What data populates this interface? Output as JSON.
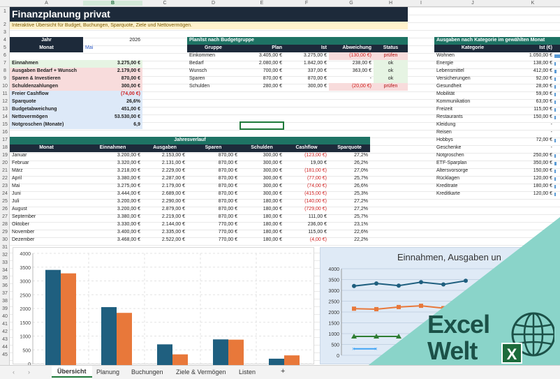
{
  "columns": [
    "A",
    "B",
    "C",
    "D",
    "E",
    "F",
    "G",
    "H",
    "I",
    "J",
    "K"
  ],
  "rows": [
    "1",
    "2",
    "3",
    "4",
    "5",
    "6",
    "7",
    "8",
    "9",
    "10",
    "11",
    "12",
    "13",
    "14",
    "15",
    "16",
    "17",
    "18",
    "19",
    "20",
    "21",
    "22",
    "23",
    "24",
    "25",
    "26",
    "27",
    "28",
    "29",
    "30",
    "31",
    "32",
    "33",
    "34",
    "35",
    "36",
    "37",
    "38",
    "39",
    "40",
    "41",
    "42",
    "43",
    "44",
    "45"
  ],
  "title": "Finanzplanung privat",
  "subtitle": "Interaktive Übersicht für Budget, Buchungen, Sparquote, Ziele und Nettovermögen.",
  "summary": {
    "jahr_label": "Jahr",
    "jahr_value": "2026",
    "monat_label": "Monat",
    "monat_value": "Mai",
    "rows": [
      {
        "label": "Einnahmen",
        "value": "3.275,00 €"
      },
      {
        "label": "Ausgaben Bedarf + Wunsch",
        "value": "2.179,00 €"
      },
      {
        "label": "Sparen & Investieren",
        "value": "870,00 €"
      },
      {
        "label": "Schuldenzahlungen",
        "value": "300,00 €"
      },
      {
        "label": "Freier Cashflow",
        "value": "(74,00 €)"
      },
      {
        "label": "Sparquote",
        "value": "26,6%"
      },
      {
        "label": "Budgetabweichung",
        "value": "451,00 €"
      },
      {
        "label": "Nettovermögen",
        "value": "53.530,00 €"
      },
      {
        "label": "Notgroschen (Monate)",
        "value": "6,9"
      }
    ]
  },
  "planist": {
    "title": "Plan/Ist nach Budgetgruppe",
    "headers": [
      "Gruppe",
      "Plan",
      "Ist",
      "Abweichung",
      "Status"
    ],
    "rows": [
      [
        "Einkommen",
        "3.405,00 €",
        "3.275,00 €",
        "(130,00 €)",
        "prüfen"
      ],
      [
        "Bedarf",
        "2.080,00 €",
        "1.842,00 €",
        "238,00 €",
        "ok"
      ],
      [
        "Wunsch",
        "700,00 €",
        "337,00 €",
        "363,00 €",
        "ok"
      ],
      [
        "Sparen",
        "870,00 €",
        "870,00 €",
        "-",
        "ok"
      ],
      [
        "Schulden",
        "280,00 €",
        "300,00 €",
        "(20,00 €)",
        "prüfen"
      ]
    ]
  },
  "kategorie": {
    "title": "Ausgaben nach Kategorie im gewählten Monat",
    "headers": [
      "Kategorie",
      "Ist (€)"
    ],
    "rows": [
      [
        "Wohnen",
        "1.050,00 €",
        1050
      ],
      [
        "Energie",
        "138,00 €",
        138
      ],
      [
        "Lebensmittel",
        "412,00 €",
        412
      ],
      [
        "Versicherungen",
        "92,00 €",
        92
      ],
      [
        "Gesundheit",
        "28,00 €",
        28
      ],
      [
        "Mobilität",
        "59,00 €",
        59
      ],
      [
        "Kommunikation",
        "63,00 €",
        63
      ],
      [
        "Freizeit",
        "115,00 €",
        115
      ],
      [
        "Restaurants",
        "150,00 €",
        150
      ],
      [
        "Kleidung",
        "-",
        0
      ],
      [
        "Reisen",
        "-",
        0
      ],
      [
        "Hobbys",
        "72,00 €",
        72
      ],
      [
        "Geschenke",
        "-",
        0
      ],
      [
        "Notgroschen",
        "250,00 €",
        250
      ],
      [
        "ETF-Sparplan",
        "350,00 €",
        350
      ],
      [
        "Altersvorsorge",
        "150,00 €",
        150
      ],
      [
        "Rücklagen",
        "120,00 €",
        120
      ],
      [
        "Kreditrate",
        "180,00 €",
        180
      ],
      [
        "Kreditkarte",
        "120,00 €",
        120
      ]
    ]
  },
  "jahres": {
    "title": "Jahresverlauf",
    "headers": [
      "Monat",
      "Einnahmen",
      "Ausgaben",
      "Sparen",
      "Schulden",
      "Cashflow",
      "Sparquote"
    ],
    "rows": [
      [
        "Januar",
        "3.200,00 €",
        "2.153,00 €",
        "870,00 €",
        "300,00 €",
        "(123,00 €)",
        "27,2%"
      ],
      [
        "Februar",
        "3.320,00 €",
        "2.131,00 €",
        "870,00 €",
        "300,00 €",
        "19,00 €",
        "26,2%"
      ],
      [
        "März",
        "3.218,00 €",
        "2.229,00 €",
        "870,00 €",
        "300,00 €",
        "(181,00 €)",
        "27,0%"
      ],
      [
        "April",
        "3.380,00 €",
        "2.287,00 €",
        "870,00 €",
        "300,00 €",
        "(77,00 €)",
        "25,7%"
      ],
      [
        "Mai",
        "3.275,00 €",
        "2.179,00 €",
        "870,00 €",
        "300,00 €",
        "(74,00 €)",
        "26,6%"
      ],
      [
        "Juni",
        "3.444,00 €",
        "2.689,00 €",
        "870,00 €",
        "300,00 €",
        "(415,00 €)",
        "25,3%"
      ],
      [
        "Juli",
        "3.200,00 €",
        "2.290,00 €",
        "870,00 €",
        "180,00 €",
        "(140,00 €)",
        "27,2%"
      ],
      [
        "August",
        "3.200,00 €",
        "2.879,00 €",
        "870,00 €",
        "180,00 €",
        "(729,00 €)",
        "27,2%"
      ],
      [
        "September",
        "3.380,00 €",
        "2.219,00 €",
        "870,00 €",
        "180,00 €",
        "111,00 €",
        "25,7%"
      ],
      [
        "Oktober",
        "3.330,00 €",
        "2.144,00 €",
        "770,00 €",
        "180,00 €",
        "236,00 €",
        "23,1%"
      ],
      [
        "November",
        "3.400,00 €",
        "2.335,00 €",
        "770,00 €",
        "180,00 €",
        "115,00 €",
        "22,6%"
      ],
      [
        "Dezember",
        "3.468,00 €",
        "2.522,00 €",
        "770,00 €",
        "180,00 €",
        "(4,00 €)",
        "22,2%"
      ]
    ]
  },
  "chart_data": [
    {
      "type": "bar",
      "title": "",
      "categories": [
        "",
        "",
        "",
        "",
        ""
      ],
      "series": [
        {
          "values": [
            3400,
            2050,
            700,
            880,
            180
          ],
          "color": "#1f5f7f"
        },
        {
          "values": [
            3275,
            1842,
            337,
            870,
            300
          ],
          "color": "#e8783a"
        }
      ],
      "ylim": [
        0,
        4000
      ],
      "yticks": [
        "0",
        "500",
        "1000",
        "1500",
        "2000",
        "2500",
        "3000",
        "3500",
        "4000"
      ]
    },
    {
      "type": "line",
      "title": "Einnahmen, Ausgaben un",
      "ylim": [
        0,
        4000
      ],
      "yticks": [
        "0",
        "500",
        "1000",
        "1500",
        "2000",
        "2500",
        "3000",
        "3500",
        "4000"
      ],
      "series": [
        {
          "values": [
            3200,
            3320,
            3218,
            3380,
            3275,
            3444
          ],
          "color": "#1f5f7f"
        },
        {
          "values": [
            2153,
            2131,
            2229,
            2287,
            2179
          ],
          "color": "#e8783a"
        },
        {
          "values": [
            870,
            870,
            870
          ],
          "color": "#2e7d32"
        },
        {
          "values": [
            300,
            300
          ],
          "color": "#42a5f5"
        }
      ]
    }
  ],
  "tabs": [
    "Übersicht",
    "Planung",
    "Buchungen",
    "Ziele & Vermögen",
    "Listen"
  ],
  "logo": {
    "line1": "Excel",
    "line2": "Welt",
    "badge": "X"
  }
}
